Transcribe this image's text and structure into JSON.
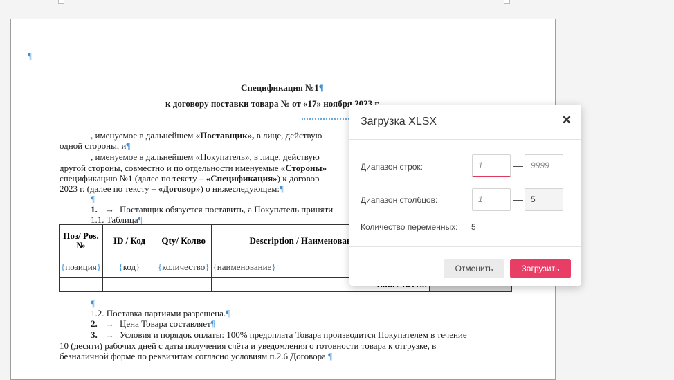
{
  "document": {
    "pilcrow": "¶",
    "title": "Спецификация №1",
    "subtitle": "к договору поставки товара № от «17» ноября 2023 г.",
    "p1a_pre": ", именуемое в дальнейшем ",
    "p1a_bold": "«Поставщик»,",
    "p1a_post": " в лице, действую",
    "p1b": "одной стороны, и",
    "p2a": ", именуемое в дальнейшем «Покупатель», в лице, действую",
    "p2b_pre": "другой стороны, совместно и по отдельности именуемые ",
    "p2b_bold": "«Стороны»",
    "p2c_pre": "спецификацию №1 (далее по тексту – ",
    "p2c_bold": "«Спецификация»",
    "p2c_post": ") к договор",
    "p2d_pre": "2023 г. (далее по тексту – ",
    "p2d_bold": "«Договор»",
    "p2d_post": ") о нижеследующем:",
    "item1_num": "1.",
    "item1_text": "Поставщик обязуется поставить, а Покупатель приняти",
    "item11": "1.1. Таблица",
    "item12": "1.2. Поставка партиями разрешена.",
    "item2_num": "2.",
    "item2_text": "Цена Товара составляет",
    "item3_num": "3.",
    "item3_line1": "Условия и порядок оплаты: 100% предоплата Товара производится Покупателем в течение",
    "item3_line2": "10 (десяти) рабочих дней с даты получения счёта и уведомления о готовности товара к отгрузке, в",
    "item3_line3": "безналичной форме по реквизитам согласно условиям п.2.6 Договора.",
    "table": {
      "h_pos": "Поз/ Pos. №",
      "h_id": "ID / Код",
      "h_qty": "Qty/ Колво",
      "h_desc": "Description / Наименование товара",
      "r_pos": "позиция",
      "r_id": "код",
      "r_qty": "количество",
      "r_desc": "наименование",
      "total": "Total / Всего:"
    }
  },
  "dialog": {
    "title": "Загрузка XLSX",
    "rows_label": "Диапазон строк:",
    "rows_from_placeholder": "1",
    "rows_to_placeholder": "9999",
    "cols_label": "Диапазон столбцов:",
    "cols_from_placeholder": "1",
    "cols_to_value": "5",
    "vars_label": "Количество переменных:",
    "vars_value": "5",
    "dash": "—",
    "cancel_label": "Отменить",
    "load_label": "Загрузить"
  }
}
